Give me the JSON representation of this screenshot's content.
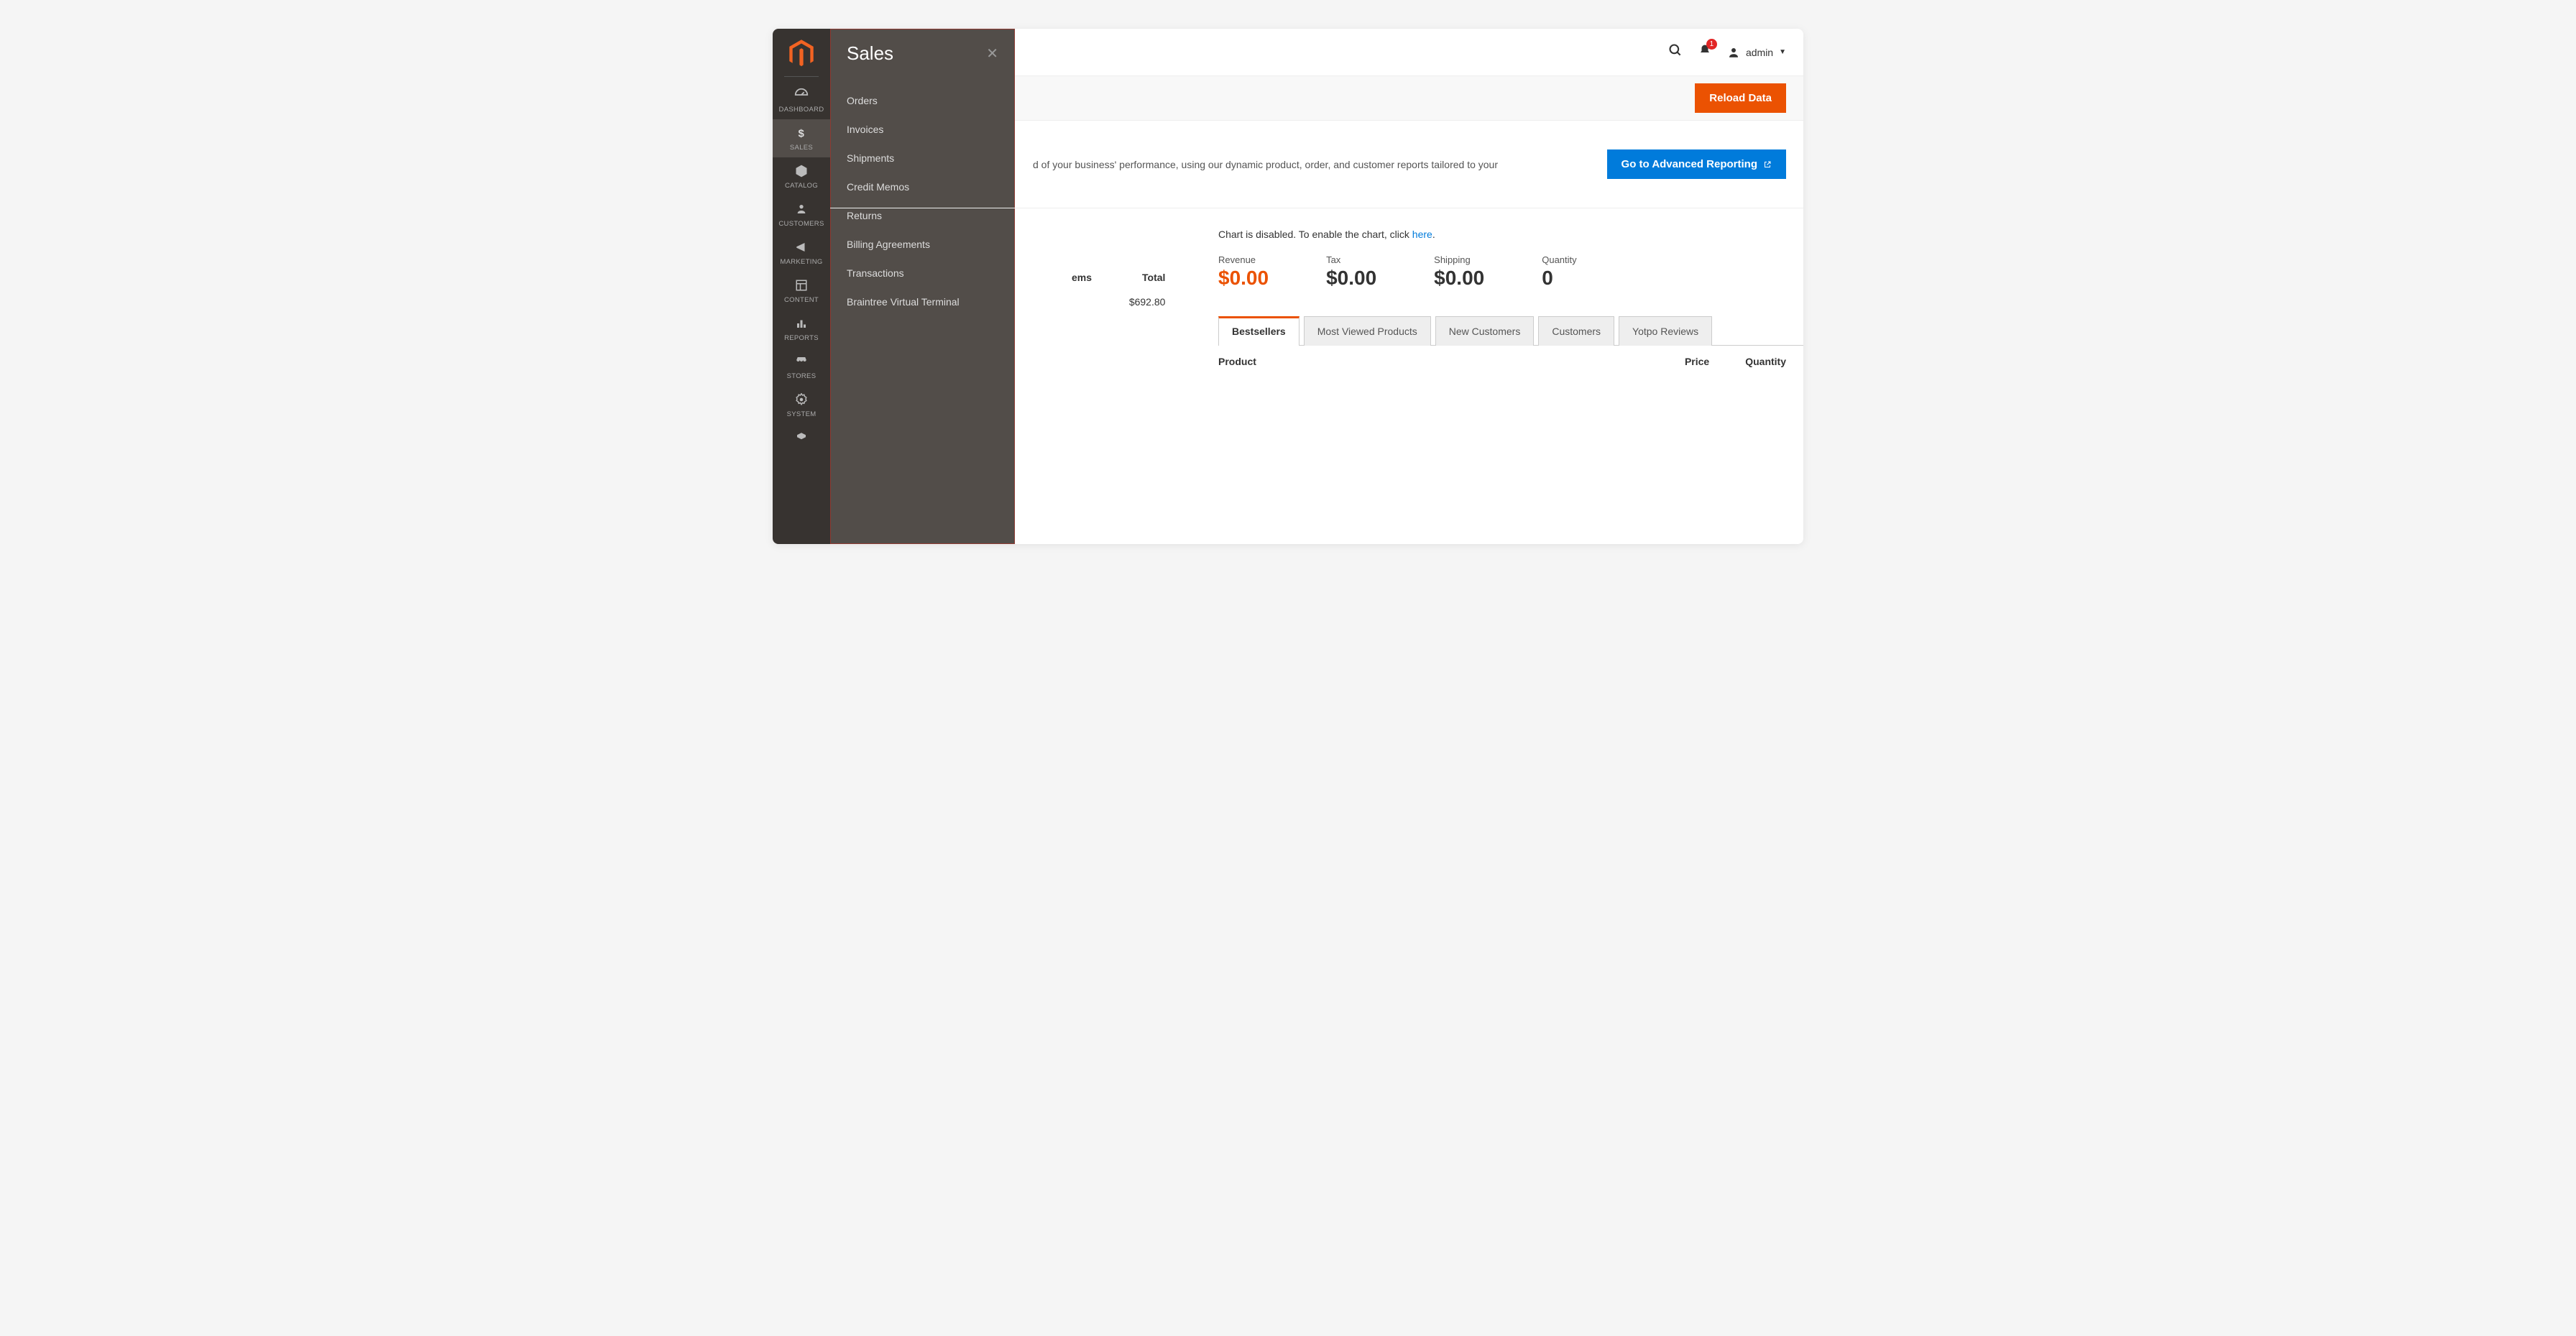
{
  "sidebar": {
    "items": [
      {
        "label": "DASHBOARD"
      },
      {
        "label": "SALES"
      },
      {
        "label": "CATALOG"
      },
      {
        "label": "CUSTOMERS"
      },
      {
        "label": "MARKETING"
      },
      {
        "label": "CONTENT"
      },
      {
        "label": "REPORTS"
      },
      {
        "label": "STORES"
      },
      {
        "label": "SYSTEM"
      }
    ]
  },
  "submenu": {
    "title": "Sales",
    "items": [
      "Orders",
      "Invoices",
      "Shipments",
      "Credit Memos",
      "Returns",
      "Billing Agreements",
      "Transactions",
      "Braintree Virtual Terminal"
    ]
  },
  "topbar": {
    "notifications": "1",
    "username": "admin"
  },
  "actions": {
    "reload": "Reload Data",
    "advanced": "Go to Advanced Reporting"
  },
  "adv_text_fragment": "d of your business' performance, using our dynamic product, order, and customer reports tailored to your",
  "chart_msg": {
    "pre": "Chart is disabled. To enable the chart, click ",
    "link": "here",
    "post": "."
  },
  "stats": {
    "revenue": {
      "label": "Revenue",
      "value": "$0.00"
    },
    "tax": {
      "label": "Tax",
      "value": "$0.00"
    },
    "shipping": {
      "label": "Shipping",
      "value": "$0.00"
    },
    "quantity": {
      "label": "Quantity",
      "value": "0"
    }
  },
  "tabs": [
    "Bestsellers",
    "Most Viewed Products",
    "New Customers",
    "Customers",
    "Yotpo Reviews"
  ],
  "table": {
    "cols": [
      "Product",
      "Price",
      "Quantity"
    ]
  },
  "left_table": {
    "head": [
      "ems",
      "Total"
    ],
    "row": [
      "",
      "$692.80"
    ]
  }
}
